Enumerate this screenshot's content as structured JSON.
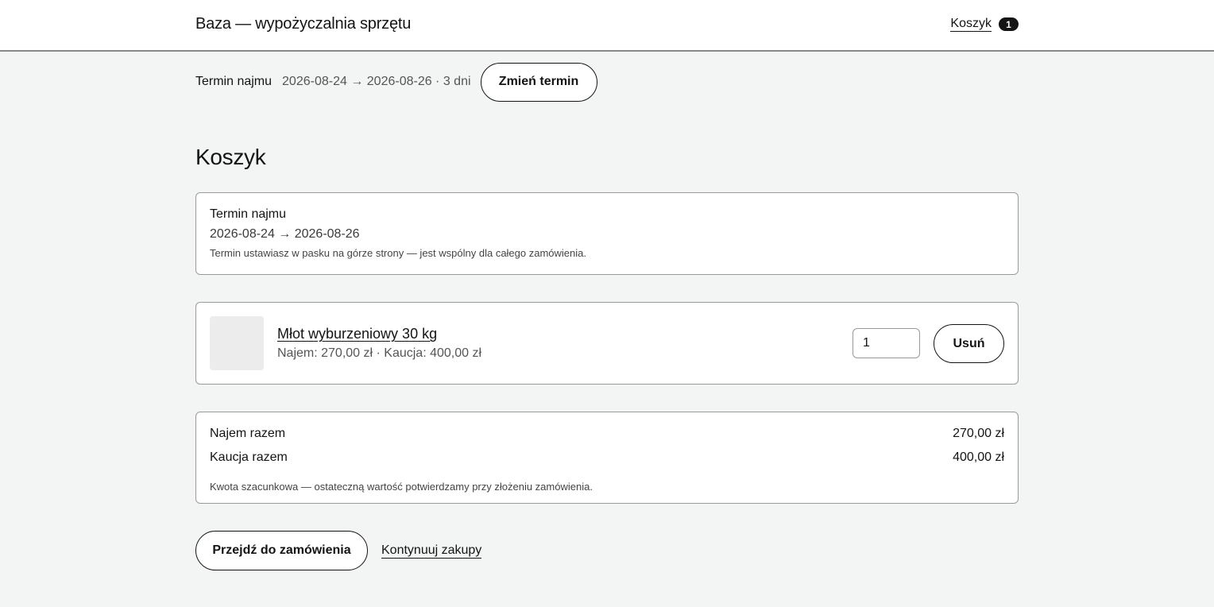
{
  "header": {
    "brand": "Baza — wypożyczalnia sprzętu",
    "cart_link": "Koszyk",
    "cart_count": "1"
  },
  "datebar": {
    "label": "Termin najmu",
    "range": "2026-08-24 → 2026-08-26 · 3 dni",
    "change_button": "Zmień termin"
  },
  "page": {
    "title": "Koszyk"
  },
  "term_card": {
    "title": "Termin najmu",
    "range": "2026-08-24 → 2026-08-26",
    "note": "Termin ustawiasz w pasku na górze strony — jest wspólny dla całego zamówienia."
  },
  "cart_item": {
    "name": "Młot wyburzeniowy 30 kg",
    "prices": "Najem: 270,00 zł · Kaucja: 400,00 zł",
    "quantity": "1",
    "remove_button": "Usuń"
  },
  "summary": {
    "rental_label": "Najem razem",
    "rental_value": "270,00 zł",
    "deposit_label": "Kaucja razem",
    "deposit_value": "400,00 zł",
    "note": "Kwota szacunkowa — ostateczną wartość potwierdzamy przy złożeniu zamówienia."
  },
  "actions": {
    "checkout_button": "Przejdź do zamówienia",
    "continue_link": "Kontynuuj zakupy"
  }
}
